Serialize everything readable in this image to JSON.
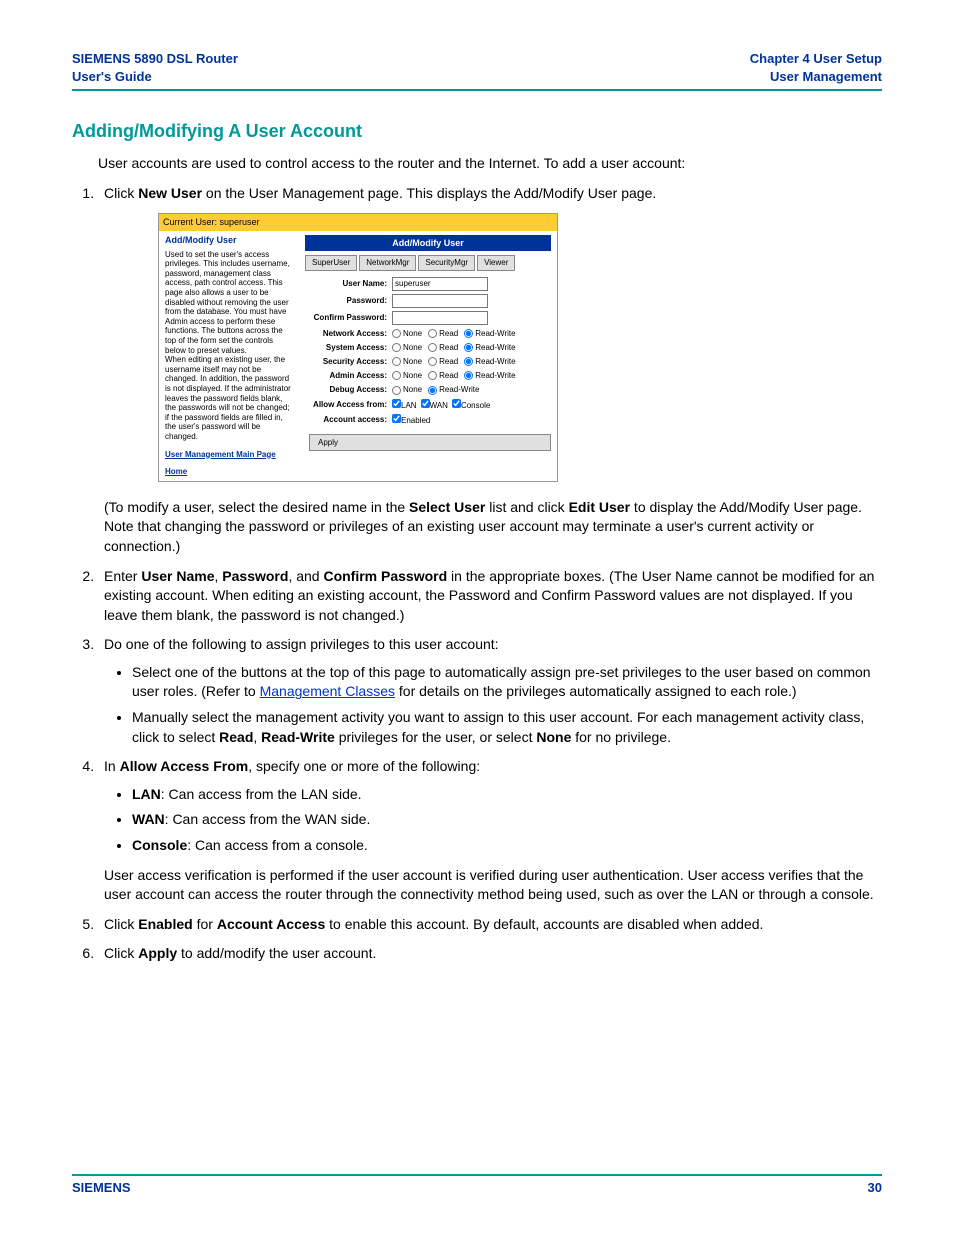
{
  "header": {
    "left_line1": "SIEMENS 5890 DSL Router",
    "left_line2": "User's Guide",
    "right_line1": "Chapter 4  User Setup",
    "right_line2": "User Management"
  },
  "section_title": "Adding/Modifying A User Account",
  "intro": "User accounts are used to control access to the router and the Internet. To add a user account:",
  "step1_a": "Click ",
  "step1_b": "New User",
  "step1_c": " on the User Management page. This displays the Add/Modify User page.",
  "screenshot": {
    "current_user_label": "Current User: superuser",
    "title": "Add/Modify User",
    "side_title": "Add/Modify User",
    "side_desc": "Used to set the user's access privileges. This includes username, password, management class access, path control access. This page also allows a user to be disabled without removing the user from the database. You must have Admin access to perform these functions. The buttons across the top of the form set the controls below to preset values.\nWhen editing an existing user, the username itself may not be changed. In addition, the password is not displayed. If the administrator leaves the password fields blank, the passwords will not be changed; if the password fields are filled in, the user's password will be changed.",
    "side_link1": "User Management Main Page",
    "side_link2": "Home",
    "presets": [
      "SuperUser",
      "NetworkMgr",
      "SecurityMgr",
      "Viewer"
    ],
    "labels": {
      "username": "User Name:",
      "password": "Password:",
      "confirm": "Confirm Password:",
      "net": "Network Access:",
      "sys": "System Access:",
      "sec": "Security Access:",
      "adm": "Admin Access:",
      "dbg": "Debug Access:",
      "allow": "Allow Access from:",
      "acct": "Account access:"
    },
    "username_value": "superuser",
    "radio_opts": {
      "none": "None",
      "read": "Read",
      "rw": "Read-Write"
    },
    "checks": {
      "lan": "LAN",
      "wan": "WAN",
      "console": "Console",
      "enabled": "Enabled"
    },
    "apply": "Apply"
  },
  "post_shot_a": "(To modify a user, select the desired name in the ",
  "post_shot_b": "Select User",
  "post_shot_c": " list and click ",
  "post_shot_d": "Edit User",
  "post_shot_e": " to display the Add/Modify User page. Note that changing the password or privileges of an existing user account may terminate a user's current activity or connection.)",
  "step2_a": "Enter ",
  "step2_b": "User Name",
  "step2_c": ", ",
  "step2_d": "Password",
  "step2_e": ", and ",
  "step2_f": "Confirm Password",
  "step2_g": " in the appropriate boxes. (The User Name cannot be modified for an existing account. When editing an existing account, the Password and Confirm Password values are not displayed. If you leave them blank, the password is not changed.)",
  "step3": "Do one of the following to assign privileges to this user account:",
  "step3_b1_a": "Select one of the buttons at the top of this page to automatically assign pre-set privileges to the user based on common user roles. (Refer to ",
  "step3_b1_link": "Management Classes",
  "step3_b1_b": " for details on the privileges automatically assigned to each role.)",
  "step3_b2_a": "Manually select the management activity you want to assign to this user account. For each management activity class, click to select ",
  "step3_b2_b": "Read",
  "step3_b2_c": ", ",
  "step3_b2_d": "Read-Write",
  "step3_b2_e": " privileges for the user, or select ",
  "step3_b2_f": "None",
  "step3_b2_g": " for no privilege.",
  "step4_a": "In ",
  "step4_b": "Allow Access From",
  "step4_c": ", specify one or more of the following:",
  "step4_lan_a": "LAN",
  "step4_lan_b": ": Can access from the LAN side.",
  "step4_wan_a": "WAN",
  "step4_wan_b": ": Can access from the WAN side.",
  "step4_con_a": "Console",
  "step4_con_b": ": Can access from a console.",
  "step4_after": "User access verification is performed if the user account is verified during user authentication. User access verifies that the user account can access the router through the connectivity method being used, such as over the LAN or through a console.",
  "step5_a": "Click ",
  "step5_b": "Enabled",
  "step5_c": " for ",
  "step5_d": "Account Access",
  "step5_e": " to enable this account. By default, accounts are disabled when added.",
  "step6_a": "Click ",
  "step6_b": "Apply",
  "step6_c": " to add/modify the user account.",
  "footer": {
    "left": "SIEMENS",
    "right": "30"
  }
}
